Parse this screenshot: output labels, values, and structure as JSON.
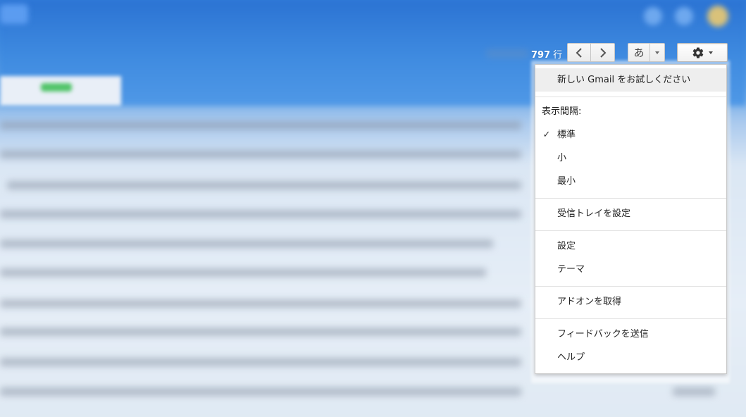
{
  "toolbar": {
    "count_value": "797",
    "count_unit": "行",
    "prev_icon": "chevron-left-icon",
    "next_icon": "chevron-right-icon",
    "ime_label": "あ",
    "settings_icon": "gear-icon"
  },
  "menu": {
    "try_new_gmail": "新しい Gmail をお試しください",
    "density_heading": "表示間隔:",
    "density_options": [
      {
        "label": "標準",
        "selected": true
      },
      {
        "label": "小",
        "selected": false
      },
      {
        "label": "最小",
        "selected": false
      }
    ],
    "check_mark": "✓",
    "configure_inbox": "受信トレイを設定",
    "settings": "設定",
    "themes": "テーマ",
    "get_addons": "アドオンを取得",
    "send_feedback": "フィードバックを送信",
    "help": "ヘルプ"
  },
  "colors": {
    "accent_blue": "#3f8be0",
    "menu_highlight": "#eeeeee"
  }
}
